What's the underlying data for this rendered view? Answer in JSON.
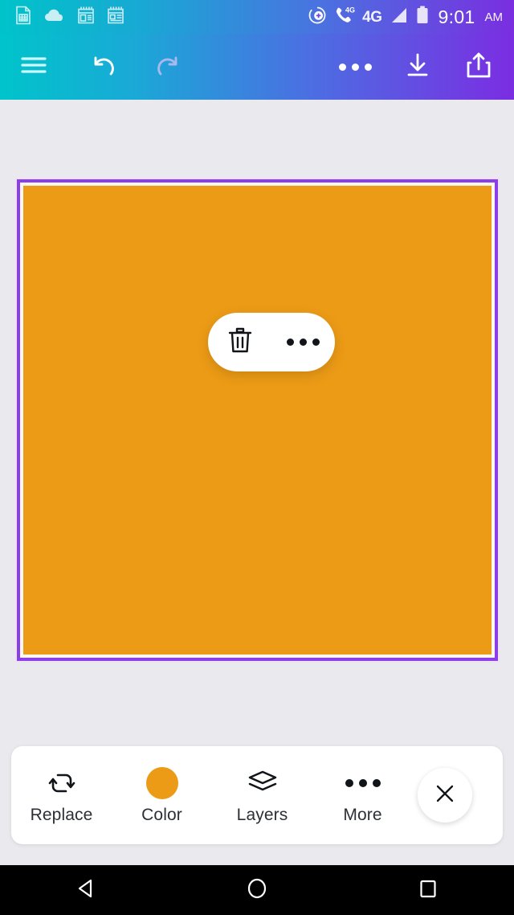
{
  "status_bar": {
    "time": "9:01",
    "meridiem": "AM",
    "network_label": "4G",
    "call_network_label": "4G",
    "left_icons": [
      {
        "name": "spreadsheet-doc-icon",
        "label": "Spreadsheet document"
      },
      {
        "name": "cloud-icon",
        "label": "Cloud sync"
      },
      {
        "name": "calendar-note-icon",
        "label": "Calendar note"
      },
      {
        "name": "calendar-note-alt-icon",
        "label": "Calendar note alternate"
      }
    ],
    "right_icons": [
      {
        "name": "add-circle-icon",
        "label": "Add"
      },
      {
        "name": "phone-4g-icon",
        "label": "Call over 4G"
      },
      {
        "name": "signal-bars-icon",
        "label": "Signal strength"
      },
      {
        "name": "battery-icon",
        "label": "Battery"
      }
    ]
  },
  "toolbar": {
    "menu_label": "Menu",
    "undo_label": "Undo",
    "redo_label": "Redo",
    "more_label": "More options",
    "download_label": "Download",
    "share_label": "Share",
    "gradient_start": "#00C4CB",
    "gradient_end": "#7B2DE2"
  },
  "canvas": {
    "background_color": "#E9E9EE",
    "shape": {
      "type": "rectangle",
      "fill_color": "#EC9B16",
      "selection_border_color": "#8B3FE8",
      "selected": true
    },
    "floating_pill": {
      "delete_label": "Delete",
      "more_label": "More"
    }
  },
  "bottom_toolbar": {
    "items": [
      {
        "label": "Replace",
        "icon": "replace-swap-icon"
      },
      {
        "label": "Color",
        "icon": "color-swatch-icon",
        "swatch_color": "#EC9B16"
      },
      {
        "label": "Layers",
        "icon": "layers-stack-icon"
      },
      {
        "label": "More",
        "icon": "more-dots-icon"
      }
    ],
    "close_label": "Close"
  },
  "nav_bar": {
    "back_label": "Back",
    "home_label": "Home",
    "recents_label": "Recent apps"
  }
}
